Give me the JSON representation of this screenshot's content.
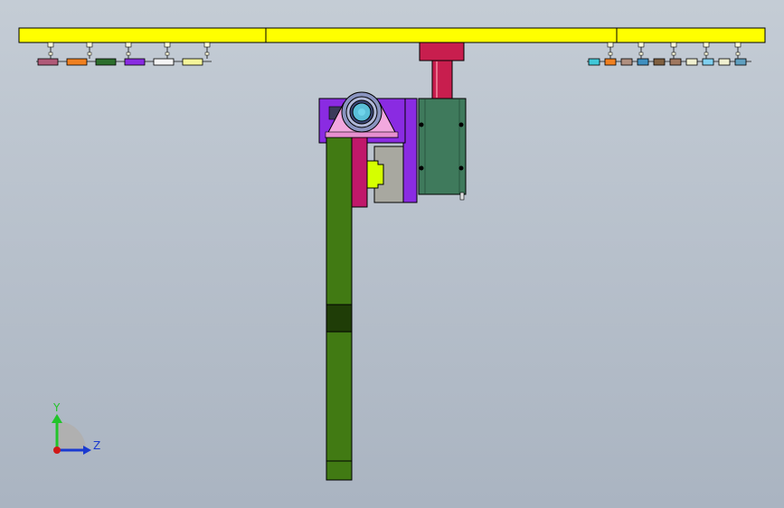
{
  "viewport": {
    "background_top": "#c4ccd5",
    "background_bottom": "#aab4c1"
  },
  "triad": {
    "y_label": "Y",
    "z_label": "Z",
    "y_color": "#22c42a",
    "z_color": "#1a3ad0",
    "x_color": "#d01818"
  },
  "colors": {
    "beam": "#ffff00",
    "column": "#417a13",
    "column_band": "#1f3d07",
    "motor": "#3f7a5c",
    "rod": "#c81e4e",
    "bracket": "#8a2be2",
    "clamp": "#f2a8de",
    "hub": "#5abfd8",
    "slider": "#c0186a",
    "block": "#a8a8a0",
    "lime": "#d5ff00"
  },
  "left_parts": [
    "#b05a78",
    "#f08020",
    "#2c6e2c",
    "#8a2be2",
    "#f4f4f4",
    "#f5f59a"
  ],
  "right_parts": [
    "#40c8d8",
    "#f08020",
    "#b09080",
    "#4090c0",
    "#806040",
    "#a07860",
    "#f0f0d0",
    "#80d0f0",
    "#f0f0d0",
    "#60a0c0"
  ]
}
